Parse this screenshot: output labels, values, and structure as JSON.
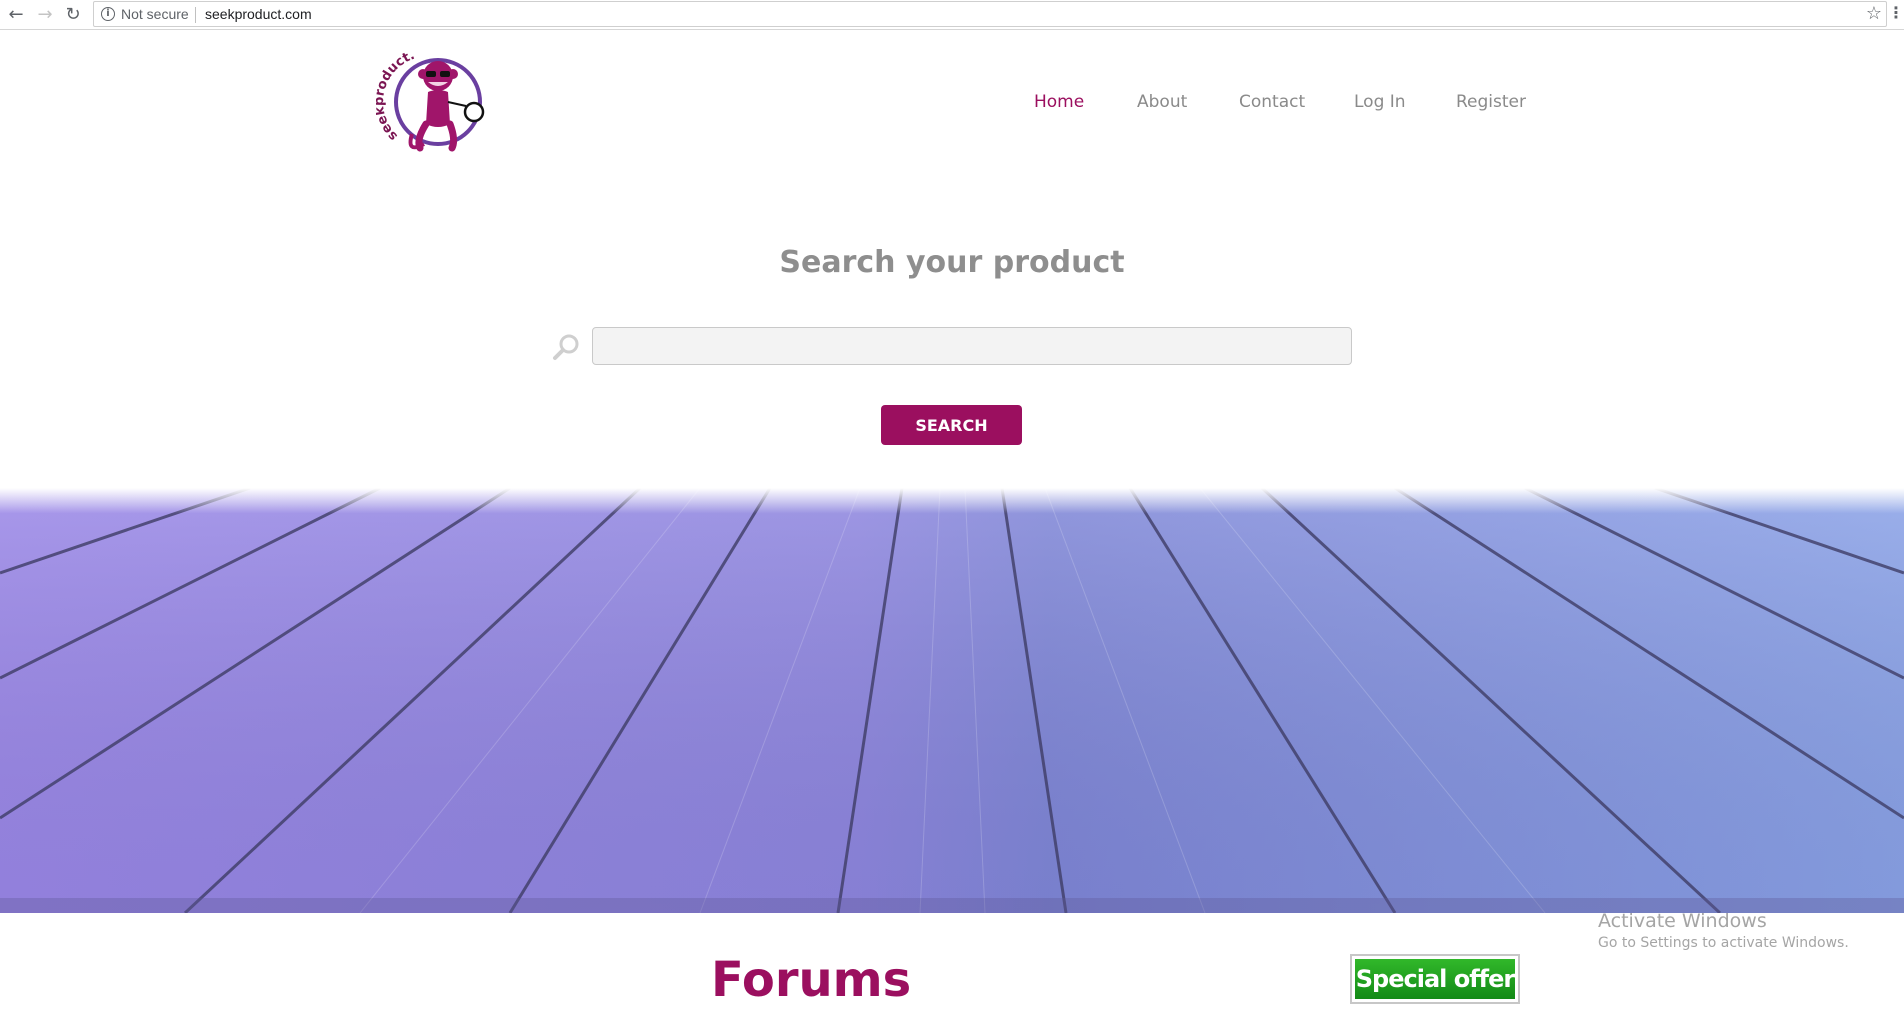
{
  "browser": {
    "back_icon": "back-arrow-icon",
    "forward_icon": "forward-arrow-icon",
    "reload_icon": "reload-icon",
    "security_label": "Not secure",
    "url": "seekproduct.com",
    "bookmark_icon": "star-icon"
  },
  "logo": {
    "text": "seekproduct.com",
    "icon": "monkey-magnifier-logo"
  },
  "nav": {
    "items": [
      {
        "label": "Home",
        "active": true
      },
      {
        "label": "About",
        "active": false
      },
      {
        "label": "Contact",
        "active": false
      },
      {
        "label": "Log In",
        "active": false
      },
      {
        "label": "Register",
        "active": false
      }
    ]
  },
  "search": {
    "title": "Search your product",
    "placeholder": "",
    "value": "",
    "button_label": "SEARCH",
    "icon": "magnifier-icon"
  },
  "hero": {
    "image": "purple-wooden-planks"
  },
  "forums": {
    "title": "Forums"
  },
  "ad": {
    "label": "Special offer"
  },
  "os_watermark": {
    "title": "Activate Windows",
    "subtitle": "Go to Settings to activate Windows."
  },
  "colors": {
    "accent": "#9b0f5f",
    "nav_text": "#8a8a8a",
    "ad_green": "#1e9c1e"
  }
}
